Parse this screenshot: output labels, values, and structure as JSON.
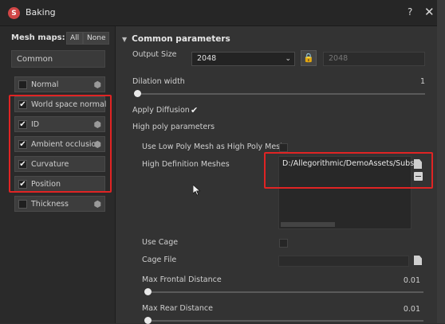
{
  "window": {
    "title": "Baking",
    "help": "?",
    "close": "✕"
  },
  "mesh_maps": {
    "label": "Mesh maps:",
    "all_button": "All",
    "none_button": "None",
    "common_button": "Common",
    "items": [
      {
        "label": "Normal",
        "checked": false,
        "icon": "cube-icon"
      },
      {
        "label": "World space normal",
        "checked": true,
        "icon": ""
      },
      {
        "label": "ID",
        "checked": true,
        "icon": "cube-icon"
      },
      {
        "label": "Ambient occlusion",
        "checked": true,
        "icon": "cube-icon"
      },
      {
        "label": "Curvature",
        "checked": true,
        "icon": ""
      },
      {
        "label": "Position",
        "checked": true,
        "icon": ""
      },
      {
        "label": "Thickness",
        "checked": false,
        "icon": "cube-icon"
      }
    ]
  },
  "common": {
    "section_title": "Common parameters",
    "output_size_label": "Output Size",
    "output_size_value": "2048",
    "output_size_linked": "2048",
    "dilation_label": "Dilation width",
    "dilation_value": "1",
    "apply_diffusion_label": "Apply Diffusion",
    "apply_diffusion_checked": true,
    "high_poly_header": "High poly parameters",
    "use_low_poly_label": "Use Low Poly Mesh as High Poly Mesh",
    "hd_meshes_label": "High Definition Meshes",
    "hd_mesh_path": "D:/Allegorithmic/DemoAssets/Subst",
    "use_cage_label": "Use Cage",
    "cage_file_label": "Cage File",
    "max_frontal_label": "Max Frontal Distance",
    "max_frontal_value": "0.01",
    "max_rear_label": "Max Rear Distance",
    "max_rear_value": "0.01"
  },
  "colors": {
    "highlight": "#e02424",
    "accent_icon": "#d14646"
  }
}
